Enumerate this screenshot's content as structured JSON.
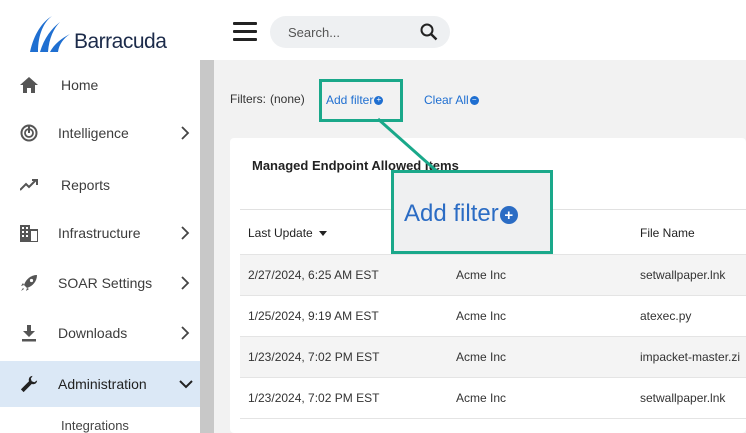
{
  "brand": {
    "name": "Barracuda",
    "accent": "#1f6fd1",
    "highlight": "#1aa88a"
  },
  "sidebar": {
    "items": [
      {
        "label": "Home",
        "icon": "home-icon",
        "has_chevron": false
      },
      {
        "label": "Intelligence",
        "icon": "intelligence-icon",
        "has_chevron": true
      },
      {
        "label": "Reports",
        "icon": "reports-trend-icon",
        "has_chevron": false
      },
      {
        "label": "Infrastructure",
        "icon": "infrastructure-building-icon",
        "has_chevron": true
      },
      {
        "label": "SOAR Settings",
        "icon": "rocket-icon",
        "has_chevron": true
      },
      {
        "label": "Downloads",
        "icon": "download-icon",
        "has_chevron": true
      },
      {
        "label": "Administration",
        "icon": "wrench-icon",
        "has_chevron": true,
        "expanded": true,
        "active": true
      }
    ],
    "sub_items": [
      {
        "label": "Integrations"
      }
    ]
  },
  "header": {
    "menu_icon": "hamburger-icon",
    "search": {
      "placeholder": "Search...",
      "value": "",
      "icon": "search-icon"
    }
  },
  "filters": {
    "label": "Filters:",
    "value": "(none)",
    "add_filter": "Add filter",
    "clear_all": "Clear All"
  },
  "table": {
    "title": "Managed Endpoint Allowed Items",
    "columns": [
      {
        "label": "Last Update",
        "sorted": "desc"
      },
      {
        "label": ""
      },
      {
        "label": "File Name"
      }
    ],
    "rows": [
      [
        "2/27/2024, 6:25 AM EST",
        "Acme Inc",
        "setwallpaper.lnk"
      ],
      [
        "1/25/2024, 9:19 AM EST",
        "Acme Inc",
        "atexec.py"
      ],
      [
        "1/23/2024, 7:02 PM EST",
        "Acme Inc",
        "impacket-master.zi"
      ],
      [
        "1/23/2024, 7:02 PM EST",
        "Acme Inc",
        "setwallpaper.lnk"
      ]
    ]
  },
  "callout": {
    "text": "Add filter"
  }
}
